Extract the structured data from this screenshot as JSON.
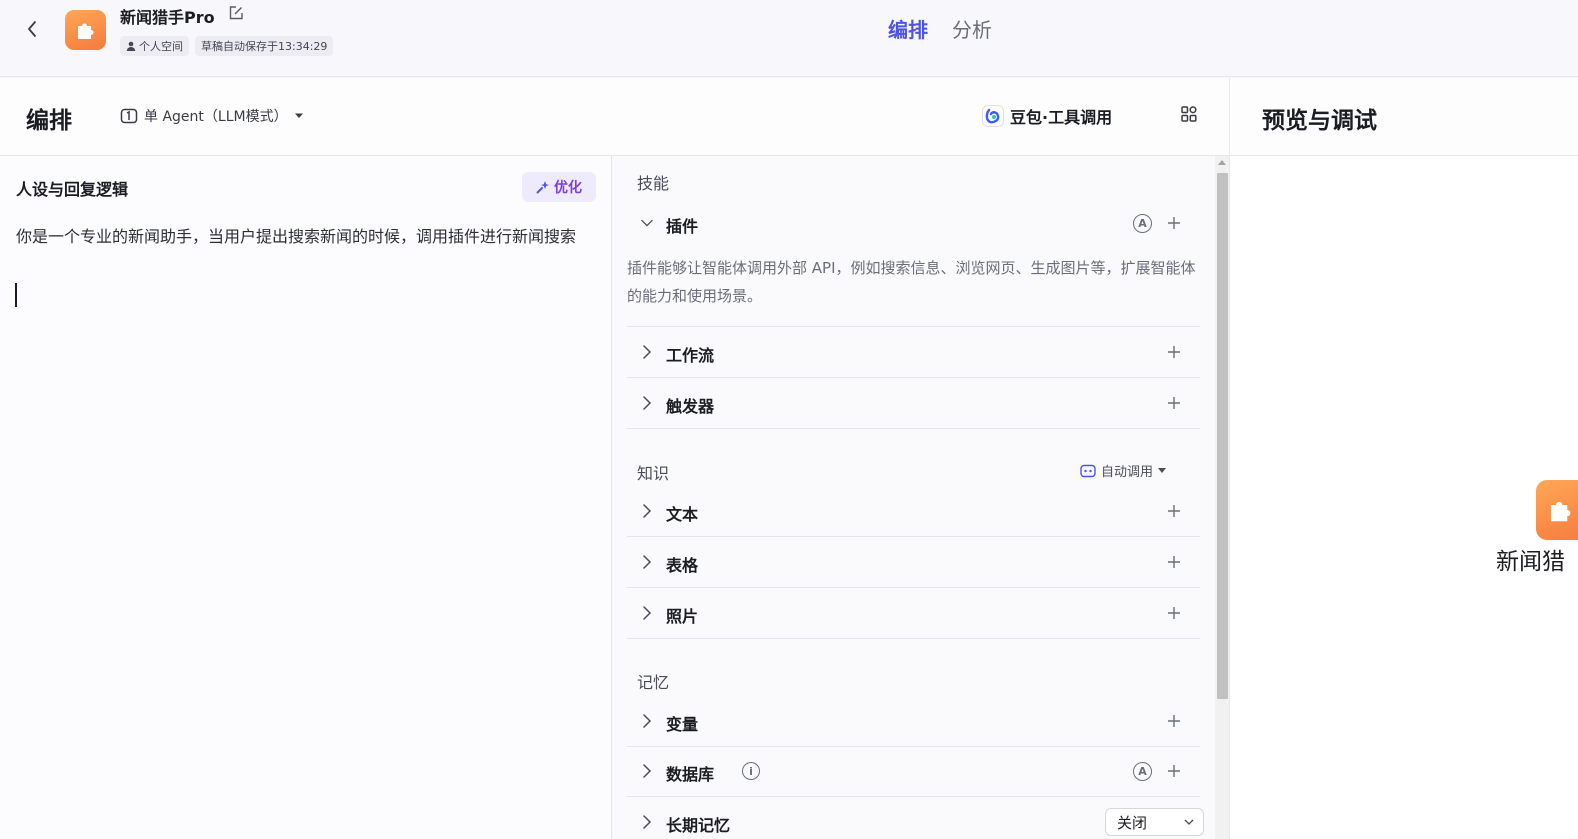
{
  "app": {
    "title": "新闻猎手Pro",
    "space_tag": "个人空间",
    "autosave": "草稿自动保存于13:34:29"
  },
  "top_tabs": [
    {
      "label": "编排",
      "active": true
    },
    {
      "label": "分析",
      "active": false
    }
  ],
  "arrange": {
    "title": "编排",
    "agent_mode": "单 Agent（LLM模式）",
    "model": "豆包·工具调用"
  },
  "preview": {
    "title": "预览与调试",
    "agent_name_partial": "新闻猎"
  },
  "prompt": {
    "title": "人设与回复逻辑",
    "optimize_label": "优化",
    "text": "你是一个专业的新闻助手，当用户提出搜索新闻的时候，调用插件进行新闻搜索"
  },
  "skills": {
    "label": "技能",
    "plugin": {
      "label": "插件",
      "description": "插件能够让智能体调用外部 API，例如搜索信息、浏览网页、生成图片等，扩展智能体的能力和使用场景。"
    },
    "workflow": "工作流",
    "trigger": "触发器"
  },
  "knowledge": {
    "label": "知识",
    "auto_call": "自动调用",
    "text": "文本",
    "table": "表格",
    "photo": "照片"
  },
  "memory": {
    "label": "记忆",
    "variable": "变量",
    "database": "数据库",
    "long_term": "长期记忆",
    "long_term_value": "关闭"
  },
  "colors": {
    "accent": "#4d53e8",
    "optimize": "#7b3fe4",
    "logo": "#f8893f"
  }
}
